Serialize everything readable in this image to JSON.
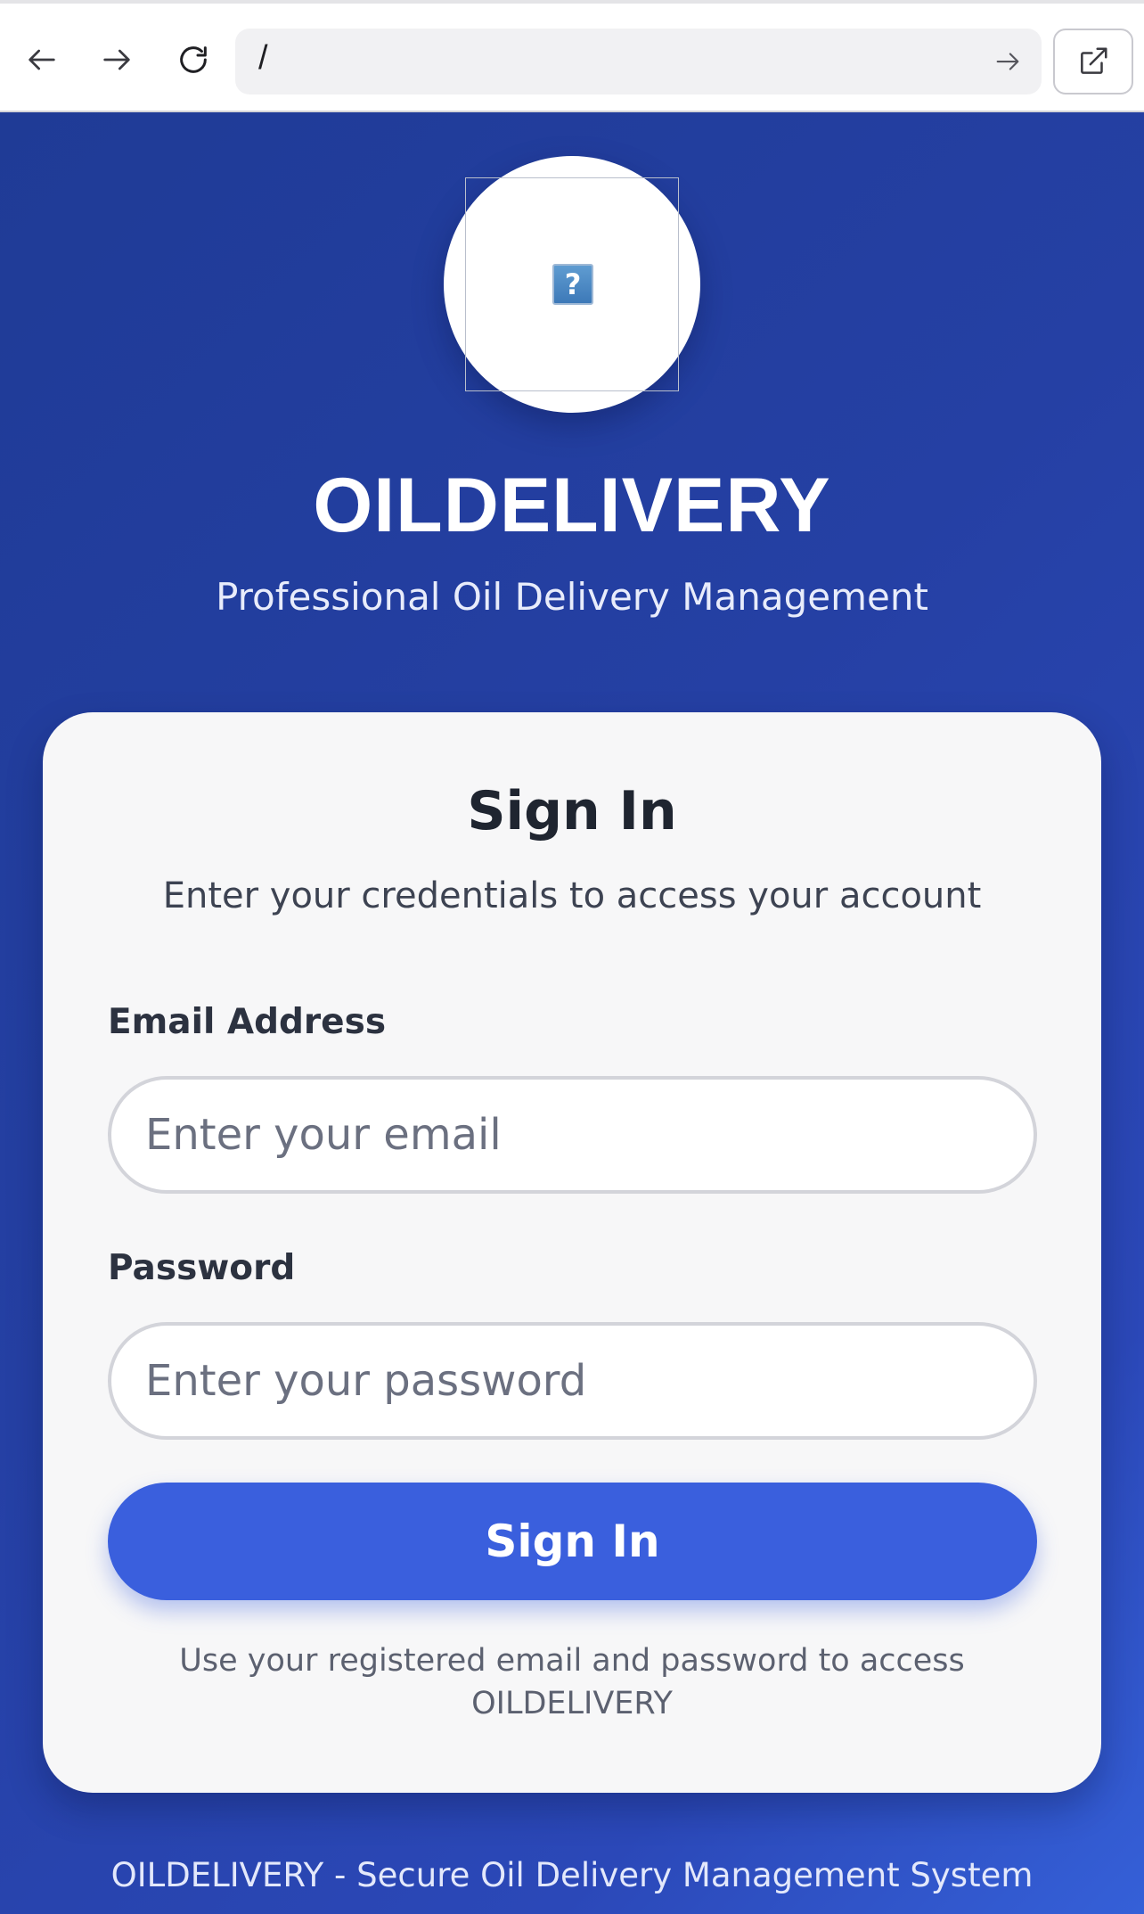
{
  "browser": {
    "address": "/",
    "icons": {
      "back": "arrow-left-icon",
      "forward": "arrow-right-icon",
      "reload": "reload-icon",
      "go": "arrow-right-icon",
      "open_external": "external-link-icon"
    }
  },
  "header": {
    "logo_placeholder_glyph": "?",
    "title": "OILDELIVERY",
    "subtitle": "Professional Oil Delivery Management"
  },
  "login_card": {
    "title": "Sign In",
    "subtitle": "Enter your credentials to access your account",
    "email_label": "Email Address",
    "email_placeholder": "Enter your email",
    "email_value": "",
    "password_label": "Password",
    "password_placeholder": "Enter your password",
    "password_value": "",
    "submit_label": "Sign In",
    "hint": "Use your registered email and password to access OILDELIVERY"
  },
  "footer": {
    "text": "OILDELIVERY - Secure Oil Delivery Management System"
  },
  "colors": {
    "background_gradient_start": "#1f3b96",
    "background_gradient_end": "#3560d8",
    "primary_button": "#3a5fdd",
    "card_background": "#f7f7f8"
  }
}
